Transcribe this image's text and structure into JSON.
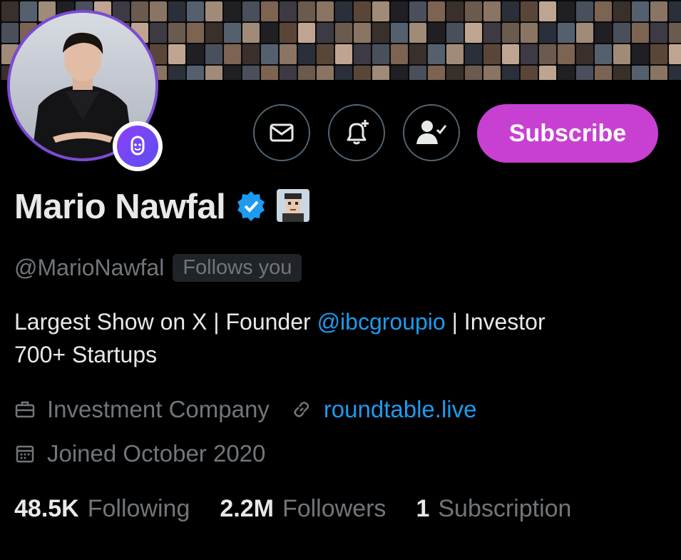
{
  "profile": {
    "display_name": "Mario Nawfal",
    "handle": "@MarioNawfal",
    "follows_you": "Follows you",
    "bio_prefix": "Largest Show on X | Founder ",
    "bio_mention": "@ibcgroupio",
    "bio_suffix": " | Investor",
    "bio_line2": "700+ Startups",
    "category": "Investment Company",
    "website": "roundtable.live",
    "joined": "Joined October 2020"
  },
  "actions": {
    "subscribe_label": "Subscribe"
  },
  "stats": {
    "following_count": "48.5K",
    "following_label": "Following",
    "followers_count": "2.2M",
    "followers_label": "Followers",
    "subscriptions_count": "1",
    "subscriptions_label": "Subscription"
  },
  "colors": {
    "background": "#000000",
    "text_primary": "#e7e9ea",
    "text_secondary": "#71767b",
    "link": "#1d9bf0",
    "subscribe_button": "#c840d2",
    "avatar_ring": "#7b4bd6",
    "verified_badge": "#1d9bf0"
  },
  "icons": {
    "message": "mail-icon",
    "notifications": "bell-plus-icon",
    "following": "person-check-icon",
    "verified": "verified-badge-icon",
    "affiliate": "pixel-avatar-icon",
    "spaces": "spaces-mic-icon",
    "category": "briefcase-icon",
    "website": "link-icon",
    "joined": "calendar-icon"
  }
}
